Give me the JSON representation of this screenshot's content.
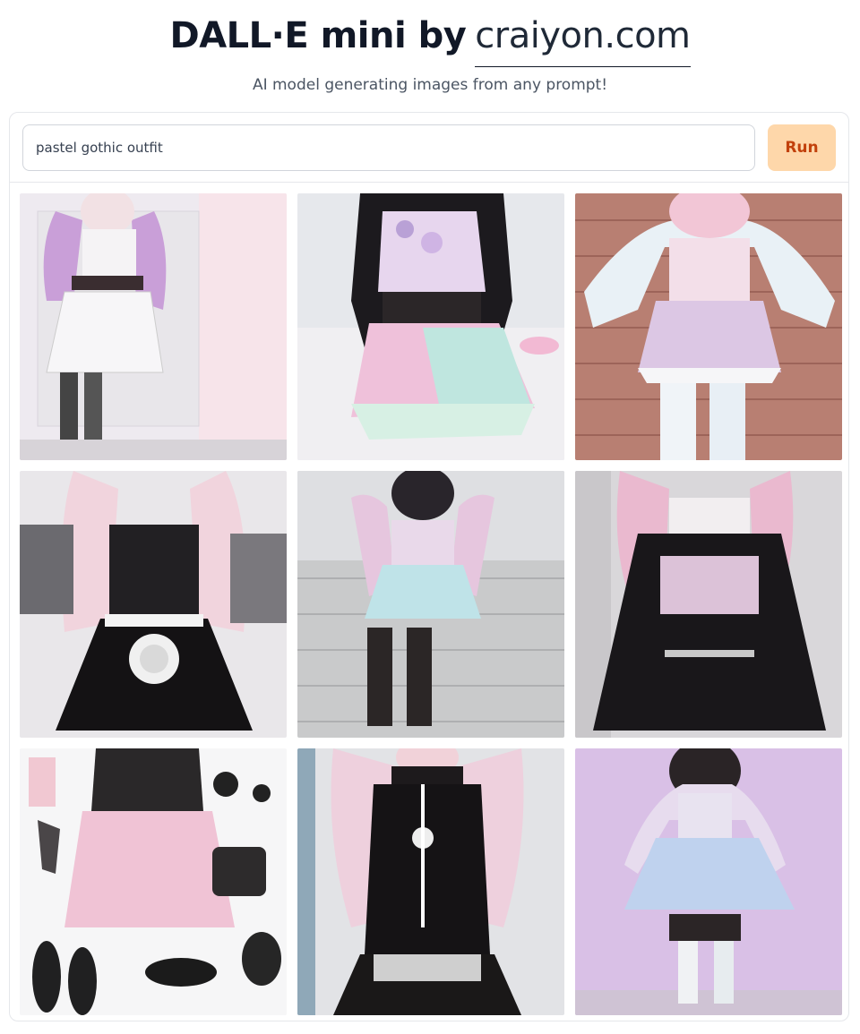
{
  "header": {
    "title_bold": "DALL·E mini by",
    "title_site": "craiyon.com",
    "subtitle": "AI model generating images from any prompt!"
  },
  "prompt": {
    "value": "pastel gothic outfit",
    "run_label": "Run"
  },
  "results": [
    {
      "name": "generated-image-1"
    },
    {
      "name": "generated-image-2"
    },
    {
      "name": "generated-image-3"
    },
    {
      "name": "generated-image-4"
    },
    {
      "name": "generated-image-5"
    },
    {
      "name": "generated-image-6"
    },
    {
      "name": "generated-image-7"
    },
    {
      "name": "generated-image-8"
    },
    {
      "name": "generated-image-9"
    }
  ]
}
